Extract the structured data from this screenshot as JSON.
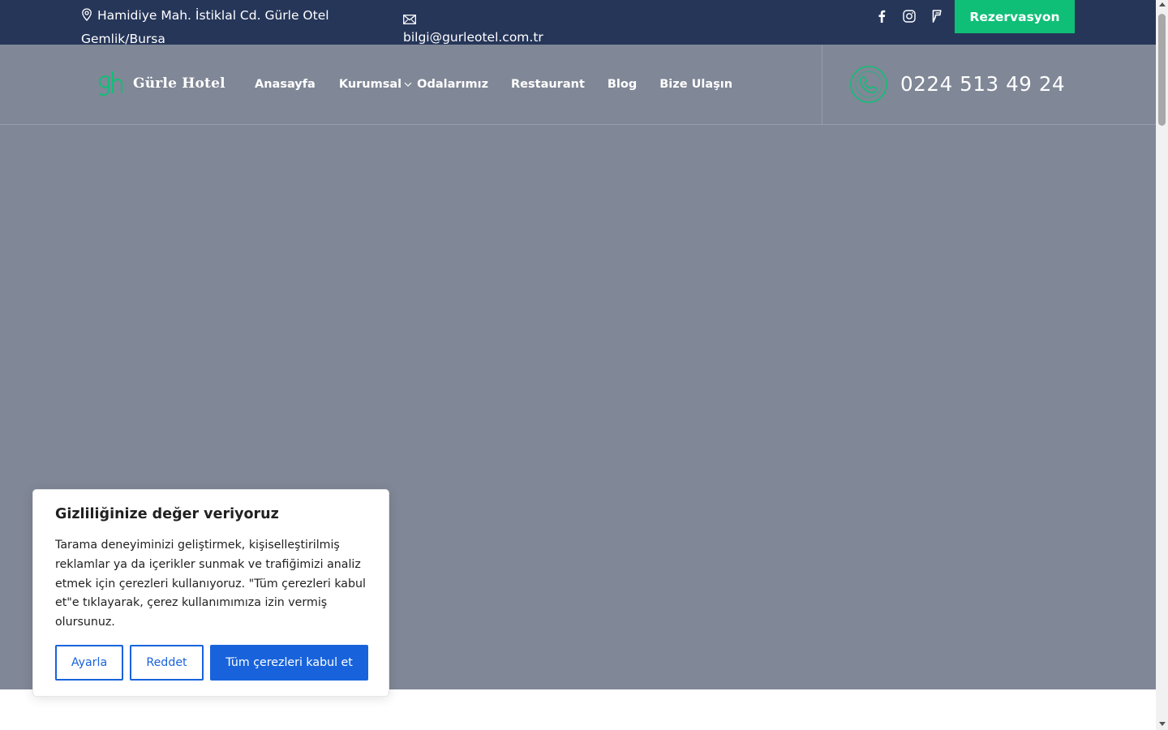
{
  "topbar": {
    "address_line1": "Hamidiye Mah. İstiklal Cd. Gürle Otel",
    "address_line2": "Gemlik/Bursa",
    "email": "bilgi@gurleotel.com.tr",
    "socials": [
      "facebook-icon",
      "instagram-icon",
      "foursquare-icon"
    ],
    "reservation_label": "Rezervasyon"
  },
  "header": {
    "logo_text": "Gürle Hotel",
    "nav": [
      {
        "label": "Anasayfa"
      },
      {
        "label": "Kurumsal"
      },
      {
        "label": "Odalarımız"
      },
      {
        "label": "Restaurant"
      },
      {
        "label": "Blog"
      },
      {
        "label": "Bize Ulaşın"
      }
    ],
    "phone": "0224 513 49 24"
  },
  "cookie": {
    "title": "Gizliliğinize değer veriyoruz",
    "body": "Tarama deneyiminizi geliştirmek, kişiselleştirilmiş reklamlar ya da içerikler sunmak ve trafiğimizi analiz etmek için çerezleri kullanıyoruz. \"Tüm çerezleri kabul et\"e tıklayarak, çerez kullanımımıza izin vermiş olursunuz.",
    "btn_customize": "Ayarla",
    "btn_reject": "Reddet",
    "btn_accept": "Tüm çerezleri kabul et"
  },
  "colors": {
    "topbar_bg": "#263659",
    "header_bg": "#808796",
    "accent_green": "#0fbf77",
    "cookie_blue": "#1863dc"
  }
}
